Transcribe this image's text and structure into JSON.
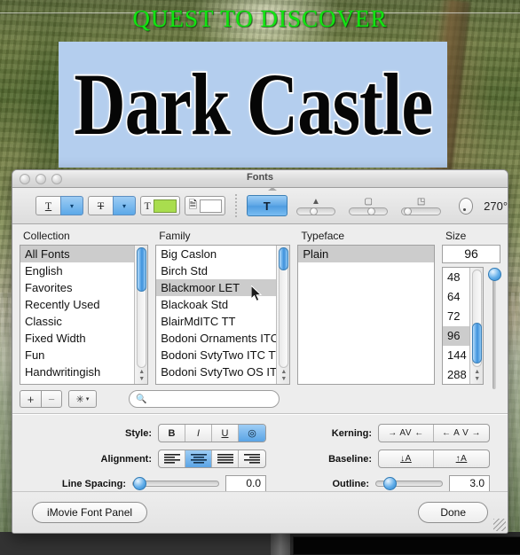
{
  "canvas": {
    "overlay_title": "QUEST TO DISCOVER",
    "main_title": "Dark Castle",
    "title_box_color": "#b4ceee",
    "overlay_title_color": "#12e412"
  },
  "window": {
    "title": "Fonts",
    "traffic_lights": [
      "close-button",
      "minimize-button",
      "zoom-button"
    ]
  },
  "toolbar": {
    "underline_label": "T",
    "underline_caret": "▾",
    "strikethrough_label": "T",
    "strikethrough_caret": "▾",
    "text_color_label": "T",
    "text_color_swatch": "#a9dd4e",
    "document_color_label": "🗎",
    "document_color_swatch": "#ffffff",
    "text_effect_label": "T",
    "shadow_opacity_icon": "▲",
    "shadow_blur_icon": "▢",
    "shadow_offset_icon": "◳",
    "rotation_value": "270°"
  },
  "panes": {
    "collection": {
      "header": "Collection",
      "items": [
        "All Fonts",
        "English",
        "Favorites",
        "Recently Used",
        "Classic",
        "Fixed Width",
        "Fun",
        "Handwritingish"
      ],
      "selected": "All Fonts"
    },
    "family": {
      "header": "Family",
      "items": [
        "Big Caslon",
        "Birch Std",
        "Blackmoor LET",
        "Blackoak Std",
        "BlairMdITC TT",
        "Bodoni Ornaments ITC",
        "Bodoni SvtyTwo ITC TT",
        "Bodoni SvtyTwo OS ITC"
      ],
      "selected": "Blackmoor LET"
    },
    "typeface": {
      "header": "Typeface",
      "items": [
        "Plain"
      ],
      "selected": "Plain"
    },
    "size": {
      "header": "Size",
      "value": "96",
      "items": [
        "48",
        "64",
        "72",
        "96",
        "144",
        "288"
      ],
      "selected": "96"
    }
  },
  "actions": {
    "add_label": "+",
    "remove_label": "−",
    "gear_label": "✳",
    "gear_caret": "▾",
    "search_placeholder": "",
    "search_value": "",
    "search_icon": "search-icon"
  },
  "controls": {
    "style_label": "Style:",
    "style_options": [
      "B",
      "I",
      "U",
      "◎"
    ],
    "style_selected_index": 3,
    "alignment_label": "Alignment:",
    "alignment_options": [
      "≡",
      "≡",
      "≡",
      "≡"
    ],
    "alignment_selected_index": 1,
    "line_spacing_label": "Line Spacing:",
    "line_spacing_value": "0.0",
    "kerning_label": "Kerning:",
    "kerning_options": [
      "→ AV ←",
      "← A V →"
    ],
    "baseline_label": "Baseline:",
    "baseline_options": [
      "↓A",
      "↑A"
    ],
    "outline_label": "Outline:",
    "outline_value": "3.0"
  },
  "footer": {
    "imovie_panel_label": "iMovie Font Panel",
    "done_label": "Done"
  }
}
